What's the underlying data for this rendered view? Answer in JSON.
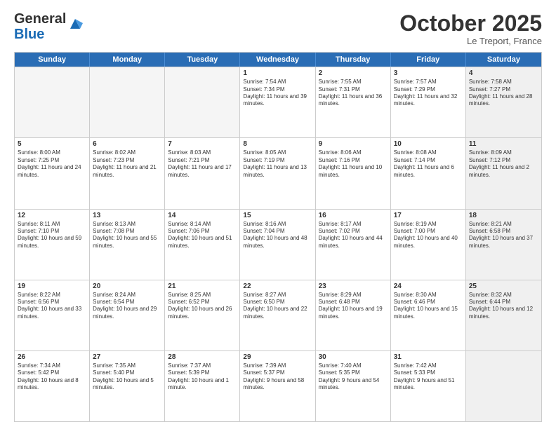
{
  "header": {
    "logo_general": "General",
    "logo_blue": "Blue",
    "month_title": "October 2025",
    "location": "Le Treport, France"
  },
  "days_of_week": [
    "Sunday",
    "Monday",
    "Tuesday",
    "Wednesday",
    "Thursday",
    "Friday",
    "Saturday"
  ],
  "rows": [
    [
      {
        "day": "",
        "empty": true
      },
      {
        "day": "",
        "empty": true
      },
      {
        "day": "",
        "empty": true
      },
      {
        "day": "1",
        "sunrise": "Sunrise: 7:54 AM",
        "sunset": "Sunset: 7:34 PM",
        "daylight": "Daylight: 11 hours and 39 minutes."
      },
      {
        "day": "2",
        "sunrise": "Sunrise: 7:55 AM",
        "sunset": "Sunset: 7:31 PM",
        "daylight": "Daylight: 11 hours and 36 minutes."
      },
      {
        "day": "3",
        "sunrise": "Sunrise: 7:57 AM",
        "sunset": "Sunset: 7:29 PM",
        "daylight": "Daylight: 11 hours and 32 minutes."
      },
      {
        "day": "4",
        "sunrise": "Sunrise: 7:58 AM",
        "sunset": "Sunset: 7:27 PM",
        "daylight": "Daylight: 11 hours and 28 minutes.",
        "shaded": true
      }
    ],
    [
      {
        "day": "5",
        "sunrise": "Sunrise: 8:00 AM",
        "sunset": "Sunset: 7:25 PM",
        "daylight": "Daylight: 11 hours and 24 minutes."
      },
      {
        "day": "6",
        "sunrise": "Sunrise: 8:02 AM",
        "sunset": "Sunset: 7:23 PM",
        "daylight": "Daylight: 11 hours and 21 minutes."
      },
      {
        "day": "7",
        "sunrise": "Sunrise: 8:03 AM",
        "sunset": "Sunset: 7:21 PM",
        "daylight": "Daylight: 11 hours and 17 minutes."
      },
      {
        "day": "8",
        "sunrise": "Sunrise: 8:05 AM",
        "sunset": "Sunset: 7:19 PM",
        "daylight": "Daylight: 11 hours and 13 minutes."
      },
      {
        "day": "9",
        "sunrise": "Sunrise: 8:06 AM",
        "sunset": "Sunset: 7:16 PM",
        "daylight": "Daylight: 11 hours and 10 minutes."
      },
      {
        "day": "10",
        "sunrise": "Sunrise: 8:08 AM",
        "sunset": "Sunset: 7:14 PM",
        "daylight": "Daylight: 11 hours and 6 minutes."
      },
      {
        "day": "11",
        "sunrise": "Sunrise: 8:09 AM",
        "sunset": "Sunset: 7:12 PM",
        "daylight": "Daylight: 11 hours and 2 minutes.",
        "shaded": true
      }
    ],
    [
      {
        "day": "12",
        "sunrise": "Sunrise: 8:11 AM",
        "sunset": "Sunset: 7:10 PM",
        "daylight": "Daylight: 10 hours and 59 minutes."
      },
      {
        "day": "13",
        "sunrise": "Sunrise: 8:13 AM",
        "sunset": "Sunset: 7:08 PM",
        "daylight": "Daylight: 10 hours and 55 minutes."
      },
      {
        "day": "14",
        "sunrise": "Sunrise: 8:14 AM",
        "sunset": "Sunset: 7:06 PM",
        "daylight": "Daylight: 10 hours and 51 minutes."
      },
      {
        "day": "15",
        "sunrise": "Sunrise: 8:16 AM",
        "sunset": "Sunset: 7:04 PM",
        "daylight": "Daylight: 10 hours and 48 minutes."
      },
      {
        "day": "16",
        "sunrise": "Sunrise: 8:17 AM",
        "sunset": "Sunset: 7:02 PM",
        "daylight": "Daylight: 10 hours and 44 minutes."
      },
      {
        "day": "17",
        "sunrise": "Sunrise: 8:19 AM",
        "sunset": "Sunset: 7:00 PM",
        "daylight": "Daylight: 10 hours and 40 minutes."
      },
      {
        "day": "18",
        "sunrise": "Sunrise: 8:21 AM",
        "sunset": "Sunset: 6:58 PM",
        "daylight": "Daylight: 10 hours and 37 minutes.",
        "shaded": true
      }
    ],
    [
      {
        "day": "19",
        "sunrise": "Sunrise: 8:22 AM",
        "sunset": "Sunset: 6:56 PM",
        "daylight": "Daylight: 10 hours and 33 minutes."
      },
      {
        "day": "20",
        "sunrise": "Sunrise: 8:24 AM",
        "sunset": "Sunset: 6:54 PM",
        "daylight": "Daylight: 10 hours and 29 minutes."
      },
      {
        "day": "21",
        "sunrise": "Sunrise: 8:25 AM",
        "sunset": "Sunset: 6:52 PM",
        "daylight": "Daylight: 10 hours and 26 minutes."
      },
      {
        "day": "22",
        "sunrise": "Sunrise: 8:27 AM",
        "sunset": "Sunset: 6:50 PM",
        "daylight": "Daylight: 10 hours and 22 minutes."
      },
      {
        "day": "23",
        "sunrise": "Sunrise: 8:29 AM",
        "sunset": "Sunset: 6:48 PM",
        "daylight": "Daylight: 10 hours and 19 minutes."
      },
      {
        "day": "24",
        "sunrise": "Sunrise: 8:30 AM",
        "sunset": "Sunset: 6:46 PM",
        "daylight": "Daylight: 10 hours and 15 minutes."
      },
      {
        "day": "25",
        "sunrise": "Sunrise: 8:32 AM",
        "sunset": "Sunset: 6:44 PM",
        "daylight": "Daylight: 10 hours and 12 minutes.",
        "shaded": true
      }
    ],
    [
      {
        "day": "26",
        "sunrise": "Sunrise: 7:34 AM",
        "sunset": "Sunset: 5:42 PM",
        "daylight": "Daylight: 10 hours and 8 minutes."
      },
      {
        "day": "27",
        "sunrise": "Sunrise: 7:35 AM",
        "sunset": "Sunset: 5:40 PM",
        "daylight": "Daylight: 10 hours and 5 minutes."
      },
      {
        "day": "28",
        "sunrise": "Sunrise: 7:37 AM",
        "sunset": "Sunset: 5:39 PM",
        "daylight": "Daylight: 10 hours and 1 minute."
      },
      {
        "day": "29",
        "sunrise": "Sunrise: 7:39 AM",
        "sunset": "Sunset: 5:37 PM",
        "daylight": "Daylight: 9 hours and 58 minutes."
      },
      {
        "day": "30",
        "sunrise": "Sunrise: 7:40 AM",
        "sunset": "Sunset: 5:35 PM",
        "daylight": "Daylight: 9 hours and 54 minutes."
      },
      {
        "day": "31",
        "sunrise": "Sunrise: 7:42 AM",
        "sunset": "Sunset: 5:33 PM",
        "daylight": "Daylight: 9 hours and 51 minutes."
      },
      {
        "day": "",
        "empty": true,
        "shaded": true
      }
    ]
  ]
}
